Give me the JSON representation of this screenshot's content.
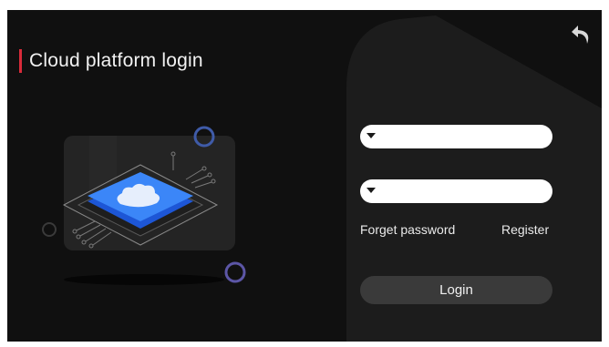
{
  "header": {
    "title": "Cloud platform login"
  },
  "icons": {
    "back": "back-arrow-icon",
    "dropdown": "caret-down-icon",
    "cloud": "cloud-chip-icon"
  },
  "form": {
    "username": {
      "value": "",
      "placeholder": ""
    },
    "password": {
      "value": "",
      "placeholder": ""
    }
  },
  "links": {
    "forget": "Forget password",
    "register": "Register"
  },
  "actions": {
    "login": "Login"
  },
  "colors": {
    "accent": "#d92b3a",
    "background": "#101010",
    "chip": "#2f7df6",
    "ring_blue": "#3f5ba8",
    "ring_purple": "#5c56a6"
  }
}
